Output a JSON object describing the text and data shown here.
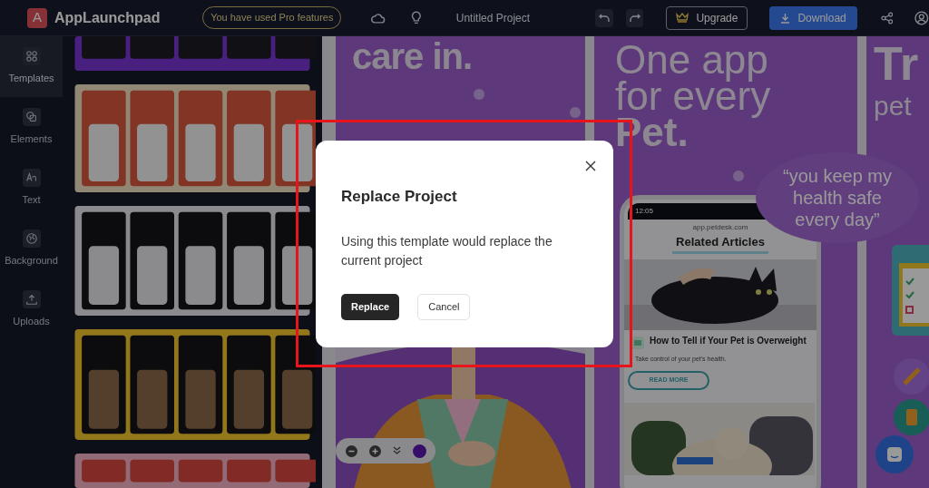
{
  "topbar": {
    "logo_letter": "A",
    "app_name": "AppLaunchpad",
    "pro_notice": "You have used Pro features",
    "project_title": "Untitled Project",
    "upgrade_label": "Upgrade",
    "download_label": "Download"
  },
  "sidebar": {
    "items": [
      {
        "label": "Templates",
        "selected": true
      },
      {
        "label": "Elements",
        "selected": false
      },
      {
        "label": "Text",
        "selected": false
      },
      {
        "label": "Background",
        "selected": false
      },
      {
        "label": "Uploads",
        "selected": false
      }
    ]
  },
  "slide_1": {
    "heading": "care in."
  },
  "slide_2": {
    "headline": [
      "One app",
      "for every"
    ],
    "headline_bold": "Pet.",
    "quote": "“you keep my health safe every day”",
    "phone": {
      "time": "12:05",
      "url": "app.petdesk.com",
      "section_title": "Related Articles",
      "article_title": "How to Tell if Your Pet is Overweight",
      "article_summary": "Take control of your pet's health.",
      "button": "READ MORE"
    }
  },
  "slide_3": {
    "heading": "Tr",
    "subheading": "pet"
  },
  "modal": {
    "title": "Replace Project",
    "message": "Using this template would replace the current project",
    "primary_button": "Replace",
    "secondary_button": "Cancel"
  }
}
